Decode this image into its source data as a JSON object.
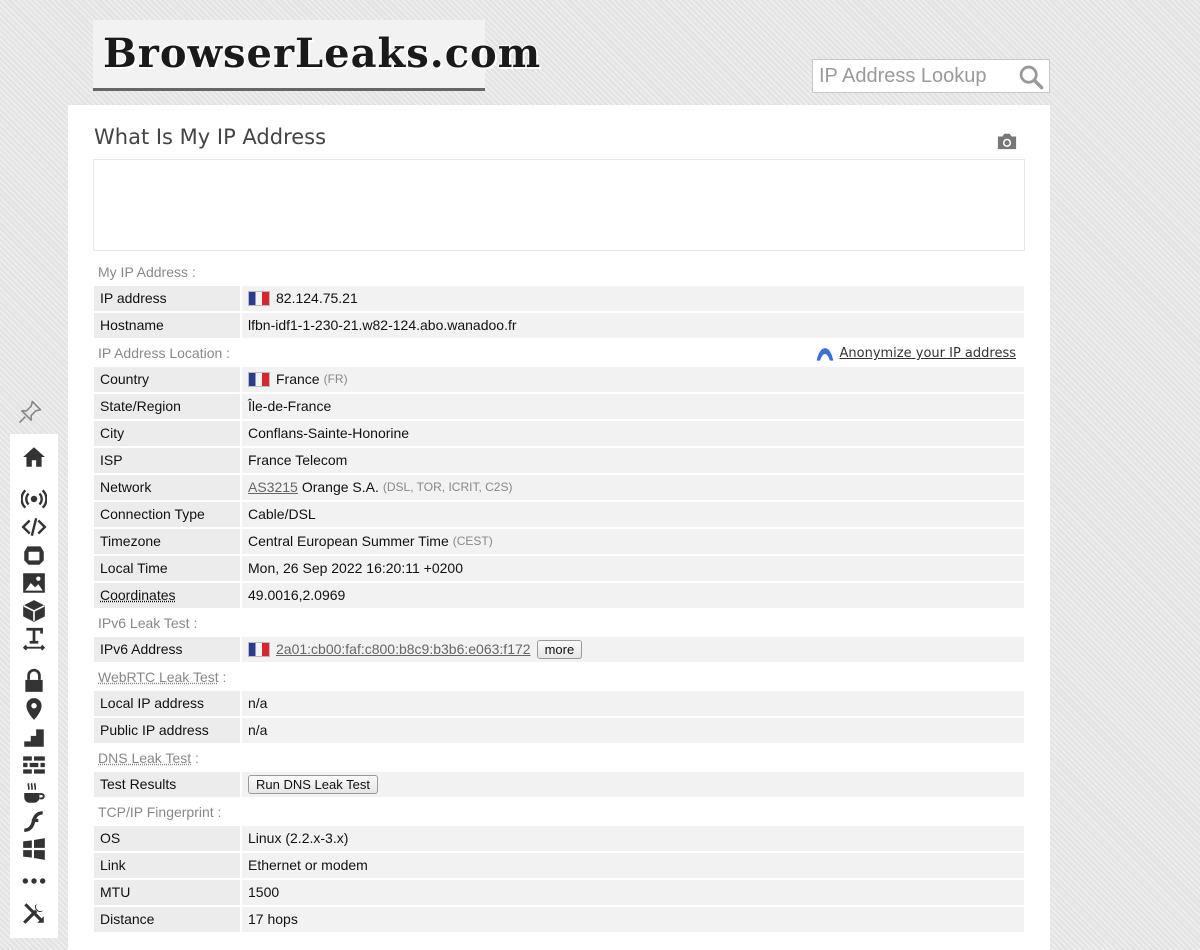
{
  "header": {
    "logo_text": "BrowserLeaks.com",
    "search_placeholder": "IP Address Lookup"
  },
  "page": {
    "title": "What Is My IP Address",
    "anonymize_label": "Anonymize your IP address"
  },
  "sections": {
    "my_ip": "My IP Address :",
    "location": "IP Address Location :",
    "ipv6": "IPv6 Leak Test :",
    "webrtc_link": "WebRTC Leak Test",
    "webrtc_colon": " :",
    "dns_link": "DNS Leak Test",
    "dns_colon": " :",
    "tcpip": "TCP/IP Fingerprint :"
  },
  "ip": {
    "ip_label": "IP address",
    "ip_value": "82.124.75.21",
    "hostname_label": "Hostname",
    "hostname_value": "lfbn-idf1-1-230-21.w82-124.abo.wanadoo.fr"
  },
  "location": {
    "country_label": "Country",
    "country_value": "France",
    "country_code": "(FR)",
    "state_label": "State/Region",
    "state_value": "Île-de-France",
    "city_label": "City",
    "city_value": "Conflans-Sainte-Honorine",
    "isp_label": "ISP",
    "isp_value": "France Telecom",
    "network_label": "Network",
    "network_asn": "AS3215",
    "network_name": "Orange S.A.",
    "network_types": "(DSL, TOR, ICRIT, C2S)",
    "conn_label": "Connection Type",
    "conn_value": "Cable/DSL",
    "tz_label": "Timezone",
    "tz_value": "Central European Summer Time",
    "tz_abbr": "(CEST)",
    "time_label": "Local Time",
    "time_value": "Mon, 26 Sep 2022 16:20:11 +0200",
    "coords_label": "Coordinates",
    "coords_value": "49.0016,2.0969"
  },
  "ipv6": {
    "label": "IPv6 Address",
    "value": "2a01:cb00:faf:c800:b8c9:b3b6:e063:f172",
    "more_label": "more"
  },
  "webrtc": {
    "local_label": "Local IP address",
    "local_value": "n/a",
    "public_label": "Public IP address",
    "public_value": "n/a"
  },
  "dns": {
    "label": "Test Results",
    "button_label": "Run DNS Leak Test"
  },
  "tcpip": {
    "os_label": "OS",
    "os_value": "Linux (2.2.x-3.x)",
    "link_label": "Link",
    "link_value": "Ethernet or modem",
    "mtu_label": "MTU",
    "mtu_value": "1500",
    "distance_label": "Distance",
    "distance_value": "17 hops"
  },
  "colors": {
    "flag_blue": "#2b3c8f",
    "flag_red": "#d8262e",
    "panel": "#ffffff",
    "row_bg": "#f2f2f2"
  },
  "sidebar_icons": [
    "home-icon",
    "broadcast-icon",
    "code-icon",
    "webgl-icon",
    "image-icon",
    "box-icon",
    "text-width-icon",
    "lock-icon",
    "location-icon",
    "stairs-icon",
    "wall-icon",
    "coffee-icon",
    "flash-icon",
    "windows-icon",
    "more-icon",
    "tools-icon"
  ]
}
